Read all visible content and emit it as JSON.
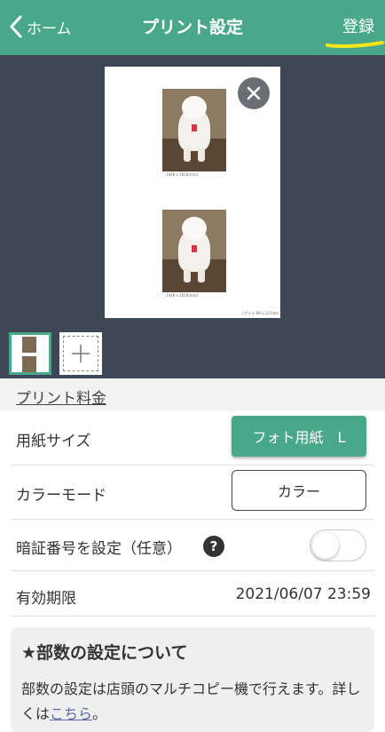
{
  "header": {
    "back_label": "ホーム",
    "title": "プリント設定",
    "register_label": "登録",
    "background_color": "#4aa88a"
  },
  "preview": {
    "photos": [
      {
        "caption": "1448 x 1650(mm)"
      },
      {
        "caption": "1448 x 1650(mm)"
      }
    ],
    "paper_size_label": "Lサイズ 89 x 127mm",
    "close_icon": "close-icon",
    "add_page_icon": "plus-icon"
  },
  "section": {
    "title": "プリント料金"
  },
  "settings": {
    "paper_size": {
      "label": "用紙サイズ",
      "value": "フォト用紙　L"
    },
    "color_mode": {
      "label": "カラーモード",
      "value": "カラー"
    },
    "pin": {
      "label": "暗証番号を設定（任意）",
      "help_glyph": "?",
      "enabled": false
    },
    "expiry": {
      "label": "有効期限",
      "value": "2021/06/07 23:59"
    }
  },
  "info": {
    "title": "★部数の設定について",
    "text": "部数の設定は店頭のマルチコピー機で行えます。詳しくは",
    "link": "こちら",
    "suffix": "。"
  }
}
